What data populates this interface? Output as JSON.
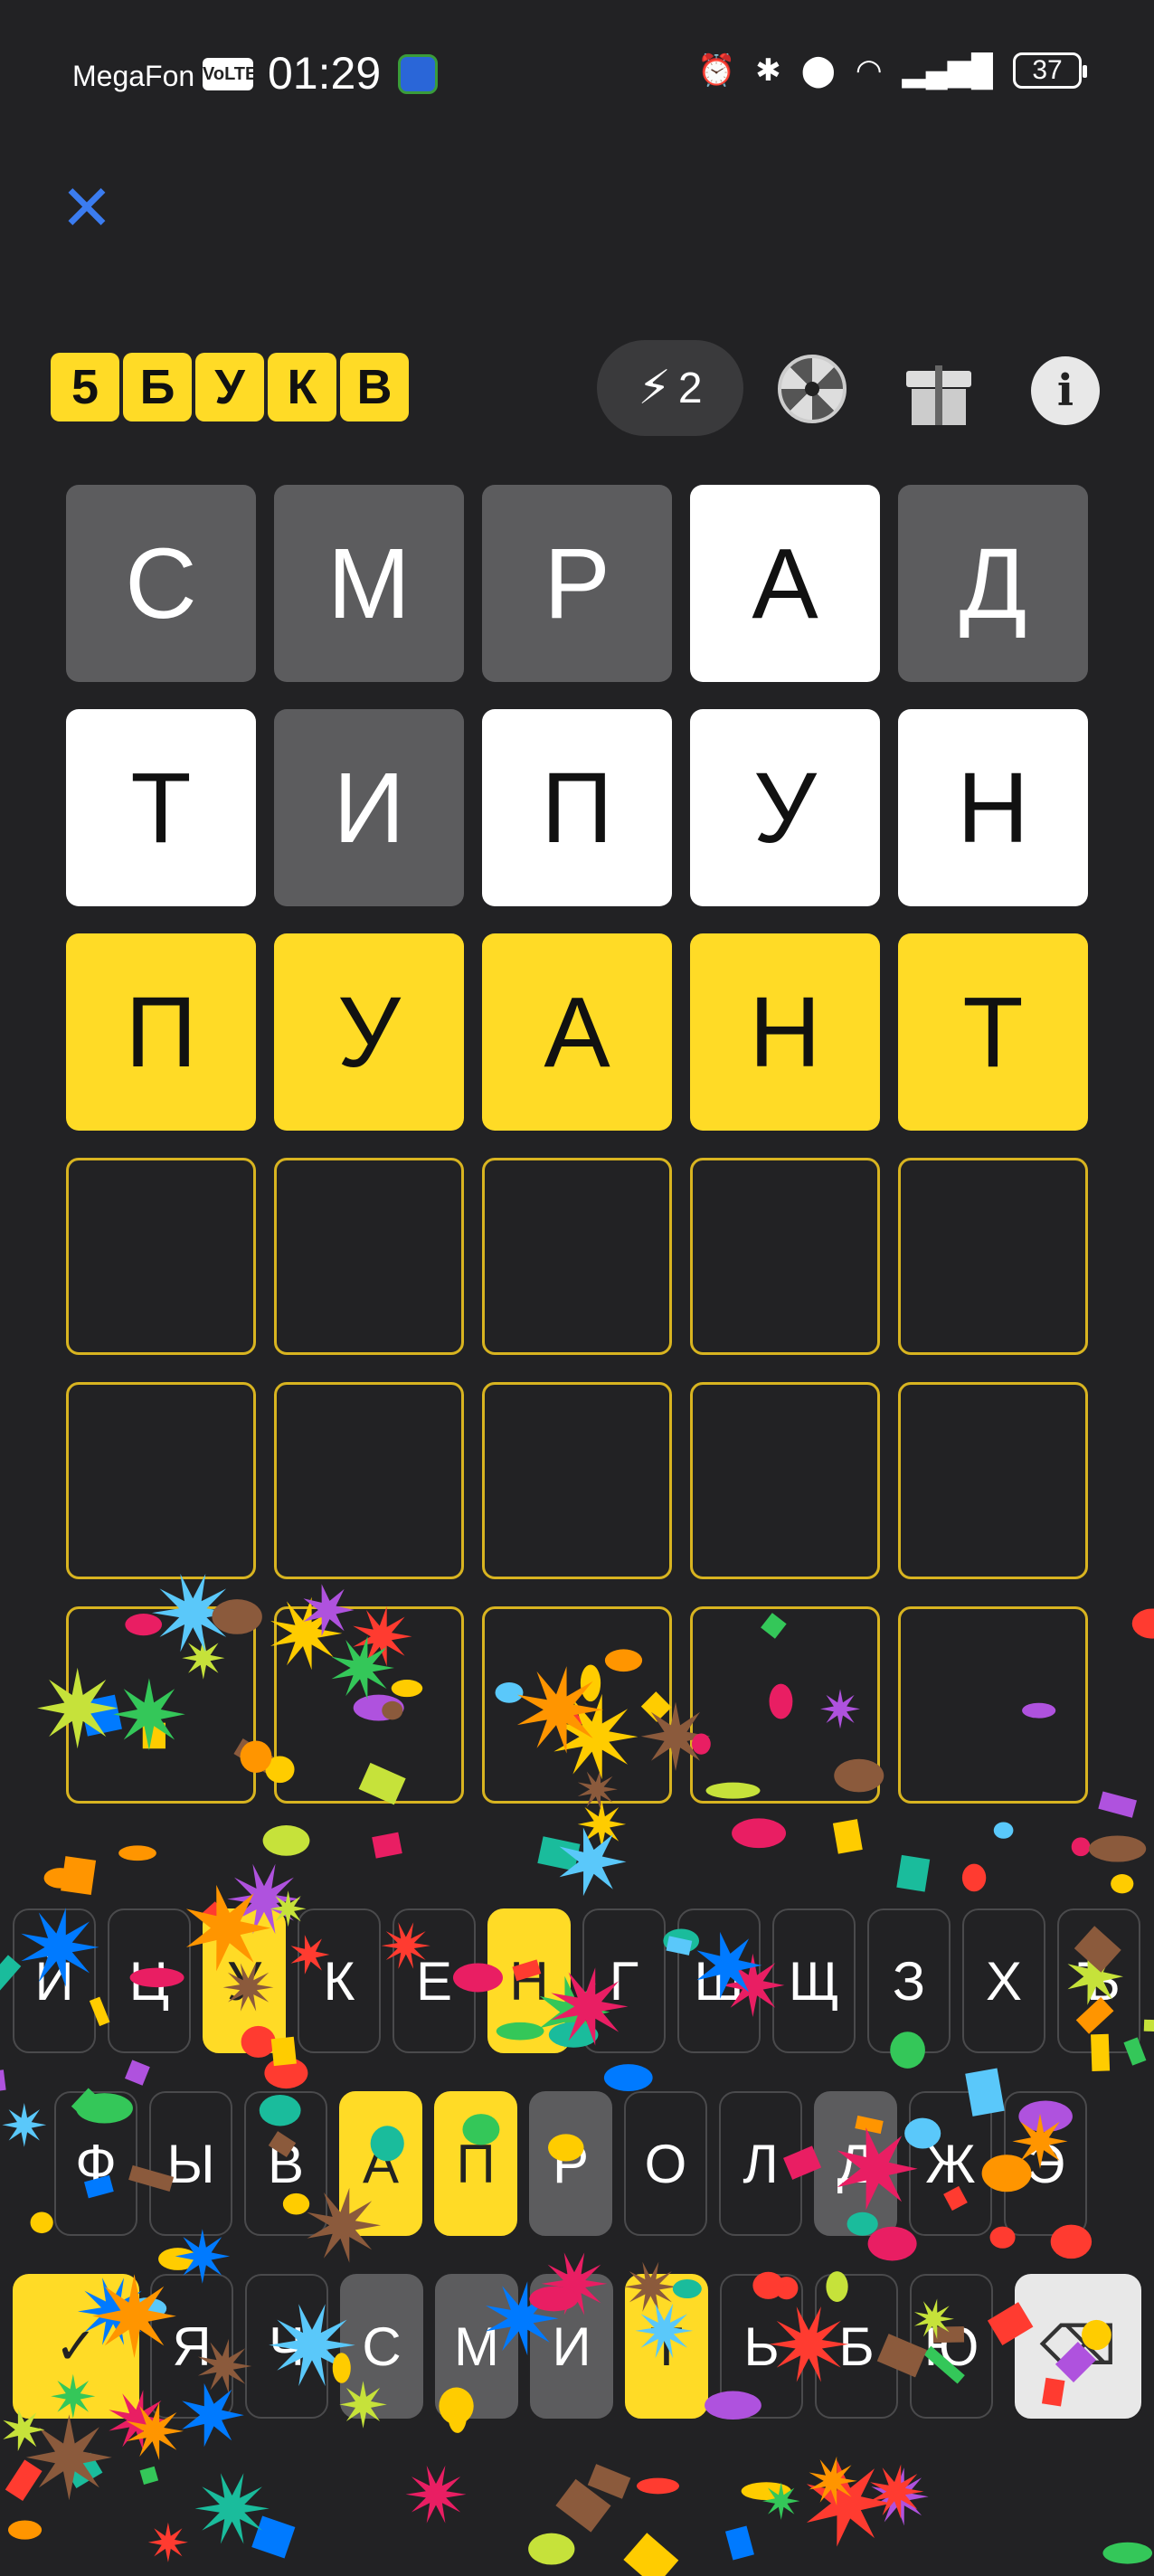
{
  "status_bar": {
    "carrier": "MegaFon",
    "volte": "VoLTE",
    "time": "01:29",
    "battery": "37"
  },
  "header": {
    "close_icon": "close-icon",
    "logo_letters": [
      "5",
      "Б",
      "У",
      "К",
      "В"
    ],
    "energy_count": "2"
  },
  "board": [
    [
      {
        "l": "С",
        "s": "absent"
      },
      {
        "l": "М",
        "s": "absent"
      },
      {
        "l": "Р",
        "s": "absent"
      },
      {
        "l": "А",
        "s": "present"
      },
      {
        "l": "Д",
        "s": "absent"
      }
    ],
    [
      {
        "l": "Т",
        "s": "present"
      },
      {
        "l": "И",
        "s": "absent"
      },
      {
        "l": "П",
        "s": "present"
      },
      {
        "l": "У",
        "s": "present"
      },
      {
        "l": "Н",
        "s": "present"
      }
    ],
    [
      {
        "l": "П",
        "s": "correct"
      },
      {
        "l": "У",
        "s": "correct"
      },
      {
        "l": "А",
        "s": "correct"
      },
      {
        "l": "Н",
        "s": "correct"
      },
      {
        "l": "Т",
        "s": "correct"
      }
    ],
    [
      {
        "l": "",
        "s": "empty"
      },
      {
        "l": "",
        "s": "empty"
      },
      {
        "l": "",
        "s": "empty"
      },
      {
        "l": "",
        "s": "empty"
      },
      {
        "l": "",
        "s": "empty"
      }
    ],
    [
      {
        "l": "",
        "s": "empty"
      },
      {
        "l": "",
        "s": "empty"
      },
      {
        "l": "",
        "s": "empty"
      },
      {
        "l": "",
        "s": "empty"
      },
      {
        "l": "",
        "s": "empty"
      }
    ],
    [
      {
        "l": "",
        "s": "empty"
      },
      {
        "l": "",
        "s": "empty"
      },
      {
        "l": "",
        "s": "empty"
      },
      {
        "l": "",
        "s": "empty"
      },
      {
        "l": "",
        "s": "empty"
      }
    ]
  ],
  "keyboard": {
    "row1": [
      {
        "k": "Й",
        "s": ""
      },
      {
        "k": "Ц",
        "s": ""
      },
      {
        "k": "У",
        "s": "correct"
      },
      {
        "k": "К",
        "s": ""
      },
      {
        "k": "Е",
        "s": ""
      },
      {
        "k": "Н",
        "s": "correct"
      },
      {
        "k": "Г",
        "s": ""
      },
      {
        "k": "Ш",
        "s": ""
      },
      {
        "k": "Щ",
        "s": ""
      },
      {
        "k": "З",
        "s": ""
      },
      {
        "k": "Х",
        "s": ""
      },
      {
        "k": "Ъ",
        "s": ""
      }
    ],
    "row2": [
      {
        "k": "Ф",
        "s": ""
      },
      {
        "k": "Ы",
        "s": ""
      },
      {
        "k": "В",
        "s": ""
      },
      {
        "k": "А",
        "s": "correct"
      },
      {
        "k": "П",
        "s": "correct"
      },
      {
        "k": "Р",
        "s": "absent"
      },
      {
        "k": "О",
        "s": ""
      },
      {
        "k": "Л",
        "s": ""
      },
      {
        "k": "Д",
        "s": "absent"
      },
      {
        "k": "Ж",
        "s": ""
      },
      {
        "k": "Э",
        "s": ""
      }
    ],
    "row3": [
      {
        "k": "Я",
        "s": ""
      },
      {
        "k": "Ч",
        "s": ""
      },
      {
        "k": "С",
        "s": "absent"
      },
      {
        "k": "М",
        "s": "absent"
      },
      {
        "k": "И",
        "s": "absent"
      },
      {
        "k": "Т",
        "s": "correct"
      },
      {
        "k": "Ь",
        "s": ""
      },
      {
        "k": "Б",
        "s": ""
      },
      {
        "k": "Ю",
        "s": ""
      }
    ],
    "enter_label": "✓",
    "backspace_icon": "backspace-icon"
  },
  "colors": {
    "correct": "#ffdb26",
    "absent": "#5c5c5e",
    "present": "#ffffff",
    "background": "#222224",
    "close": "#3b7cf0"
  }
}
